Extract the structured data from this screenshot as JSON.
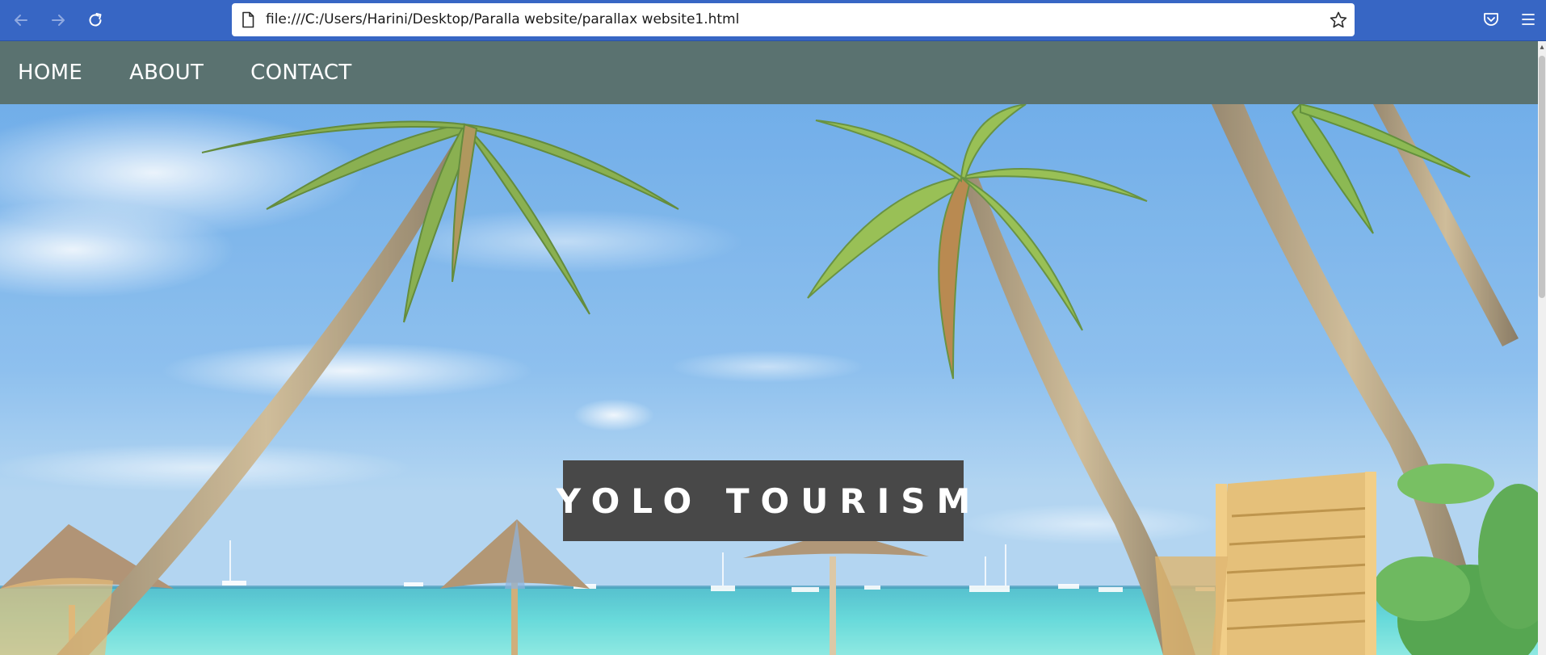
{
  "browser": {
    "url": "file:///C:/Users/Harini/Desktop/Paralla website/parallax website1.html",
    "icons": [
      "back-icon",
      "forward-icon",
      "reload-icon",
      "page-icon",
      "bookmark-star-icon",
      "pocket-icon",
      "menu-icon"
    ],
    "chrome_color": "#3766c4"
  },
  "site_nav": {
    "items": [
      {
        "label": "HOME"
      },
      {
        "label": "ABOUT"
      },
      {
        "label": "CONTACT"
      }
    ],
    "background": "#5a7270"
  },
  "hero": {
    "title": "YOLO TOURISM",
    "title_background": "#484848",
    "image": "tropical-beach-palm-trees"
  }
}
